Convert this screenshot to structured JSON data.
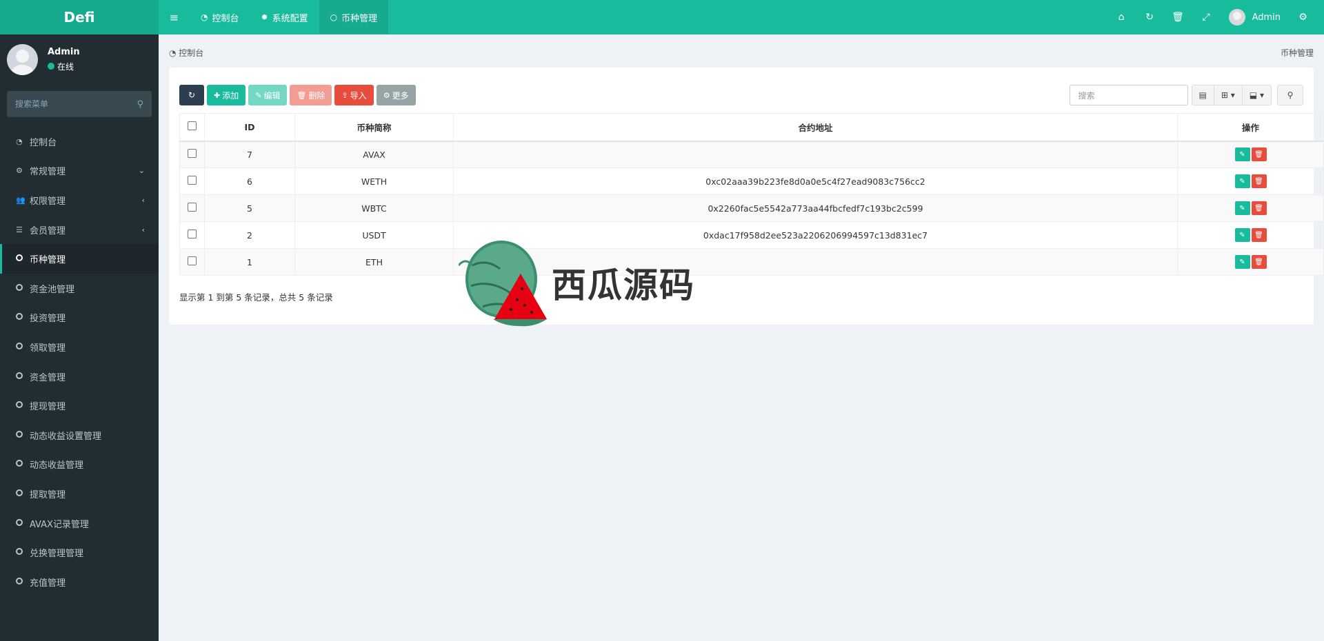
{
  "header": {
    "logo": "Defi",
    "tabs": [
      {
        "icon": "dashboard-icon",
        "label": "控制台"
      },
      {
        "icon": "gear-icon",
        "label": "系统配置"
      },
      {
        "icon": "circle-icon",
        "label": "币种管理"
      }
    ],
    "username": "Admin"
  },
  "sidebar": {
    "user": {
      "name": "Admin",
      "status": "在线"
    },
    "search_placeholder": "搜索菜单",
    "items": [
      {
        "label": "控制台",
        "icon": "dashboard-icon"
      },
      {
        "label": "常规管理",
        "icon": "cogs-icon",
        "caret": "⌄"
      },
      {
        "label": "权限管理",
        "icon": "users-icon",
        "caret": "‹"
      },
      {
        "label": "会员管理",
        "icon": "list-icon",
        "caret": "‹"
      },
      {
        "label": "币种管理",
        "icon": "circle-icon",
        "active": true
      },
      {
        "label": "资金池管理",
        "icon": "circle-icon"
      },
      {
        "label": "投资管理",
        "icon": "circle-icon"
      },
      {
        "label": "领取管理",
        "icon": "circle-icon"
      },
      {
        "label": "资金管理",
        "icon": "circle-icon"
      },
      {
        "label": "提现管理",
        "icon": "circle-icon"
      },
      {
        "label": "动态收益设置管理",
        "icon": "circle-icon"
      },
      {
        "label": "动态收益管理",
        "icon": "circle-icon"
      },
      {
        "label": "提取管理",
        "icon": "circle-icon"
      },
      {
        "label": "AVAX记录管理",
        "icon": "circle-icon"
      },
      {
        "label": "兑换管理管理",
        "icon": "circle-icon"
      },
      {
        "label": "充值管理",
        "icon": "circle-icon"
      }
    ]
  },
  "breadcrumb": {
    "left": "控制台",
    "right": "币种管理"
  },
  "toolbar": {
    "add": "添加",
    "edit": "编辑",
    "delete": "删除",
    "import": "导入",
    "more": "更多",
    "search_placeholder": "搜索"
  },
  "table": {
    "headers": [
      "ID",
      "币种简称",
      "合约地址",
      "操作"
    ],
    "rows": [
      {
        "id": "7",
        "symbol": "AVAX",
        "address": ""
      },
      {
        "id": "6",
        "symbol": "WETH",
        "address": "0xc02aaa39b223fe8d0a0e5c4f27ead9083c756cc2"
      },
      {
        "id": "5",
        "symbol": "WBTC",
        "address": "0x2260fac5e5542a773aa44fbcfedf7c193bc2c599"
      },
      {
        "id": "2",
        "symbol": "USDT",
        "address": "0xdac17f958d2ee523a2206206994597c13d831ec7"
      },
      {
        "id": "1",
        "symbol": "ETH",
        "address": ""
      }
    ]
  },
  "pagination": {
    "info": "显示第 1 到第 5 条记录，总共 5 条记录"
  },
  "watermark": {
    "text": "西瓜源码"
  },
  "colors": {
    "brand": "#18bc9c",
    "sidebar": "#222d32",
    "danger": "#e74c3c"
  }
}
